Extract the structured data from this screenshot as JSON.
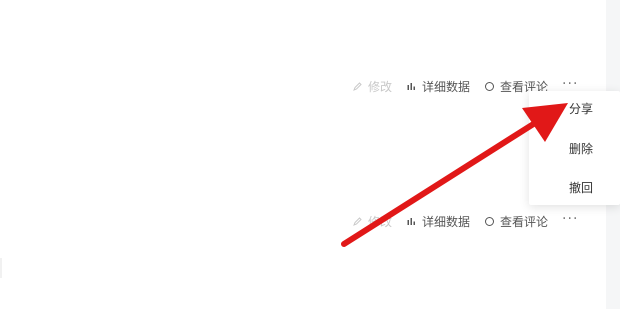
{
  "colors": {
    "annotation_arrow": "#e11818",
    "text": "#555555",
    "disabled_text": "#c9c9c9",
    "menu_text": "#333333"
  },
  "rows": [
    {
      "edit_label": "修改",
      "details_label": "详细数据",
      "comments_label": "查看评论",
      "more_label": "···"
    },
    {
      "edit_label": "修改",
      "details_label": "详细数据",
      "comments_label": "查看评论",
      "more_label": "···"
    }
  ],
  "menu": {
    "items": [
      "分享",
      "删除",
      "撤回"
    ]
  },
  "icons": {
    "edit": "pencil-icon",
    "details": "bar-chart-icon",
    "comments": "comment-bubble-icon"
  }
}
